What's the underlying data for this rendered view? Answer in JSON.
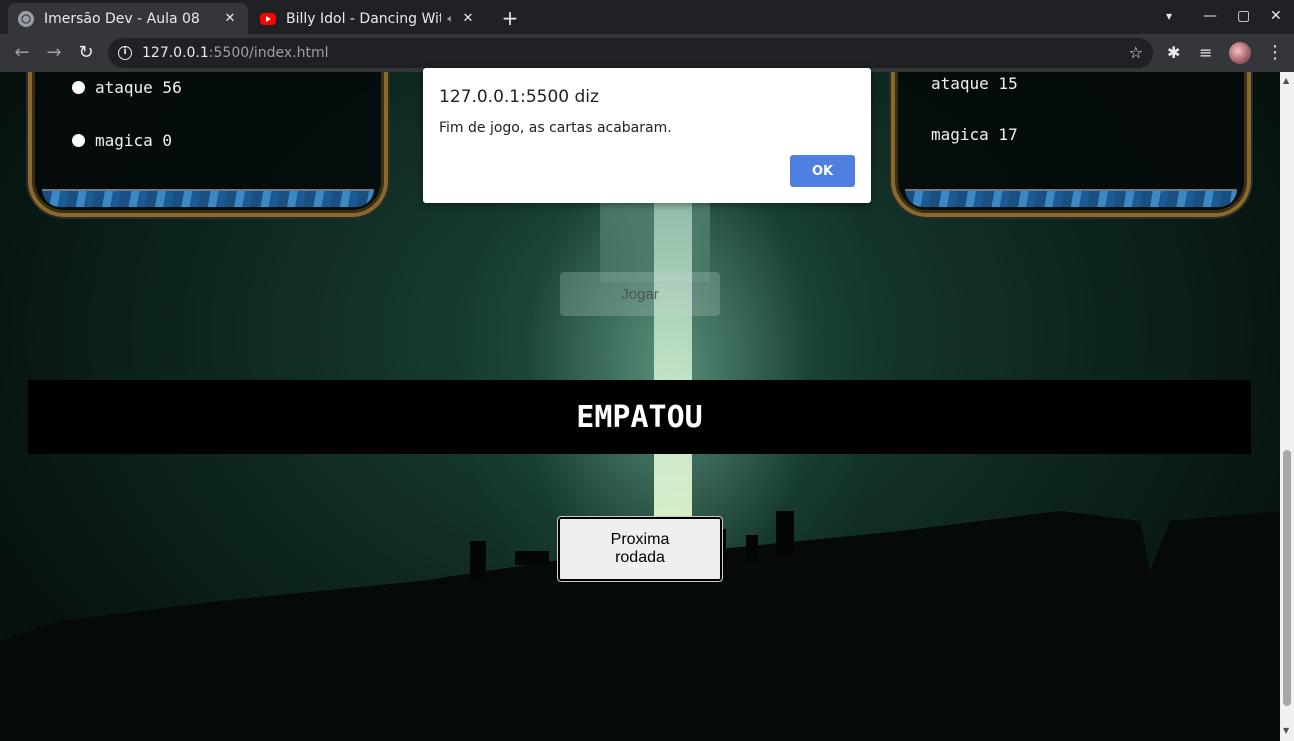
{
  "browser": {
    "tabs": [
      {
        "title": "Imersão Dev - Aula 08",
        "close": "✕"
      },
      {
        "title": "Billy Idol - Dancing With",
        "close": "✕"
      }
    ],
    "new_tab": "+",
    "address": {
      "host": "127.0.0.1",
      "path": ":5500/index.html"
    },
    "window_controls": {
      "minimize": "—",
      "maximize": "▢",
      "close": "✕"
    },
    "nav": {
      "back": "←",
      "forward": "→",
      "reload": "↻"
    },
    "icons": {
      "star": "☆",
      "extensions": "✱",
      "media": "≡",
      "menu": "⋮",
      "tab_search": "▾"
    }
  },
  "cards": {
    "left": {
      "attributes": [
        {
          "label": "ataque 56"
        },
        {
          "label": "magica 0"
        }
      ]
    },
    "right": {
      "attributes": [
        {
          "label": "ataque 15"
        },
        {
          "label": "magica 17"
        }
      ]
    }
  },
  "buttons": {
    "play": "Jogar",
    "next_round": "Proxima rodada"
  },
  "result": "EMPATOU",
  "alert": {
    "title": "127.0.0.1:5500 diz",
    "message": "Fim de jogo, as cartas acabaram.",
    "ok": "OK"
  }
}
